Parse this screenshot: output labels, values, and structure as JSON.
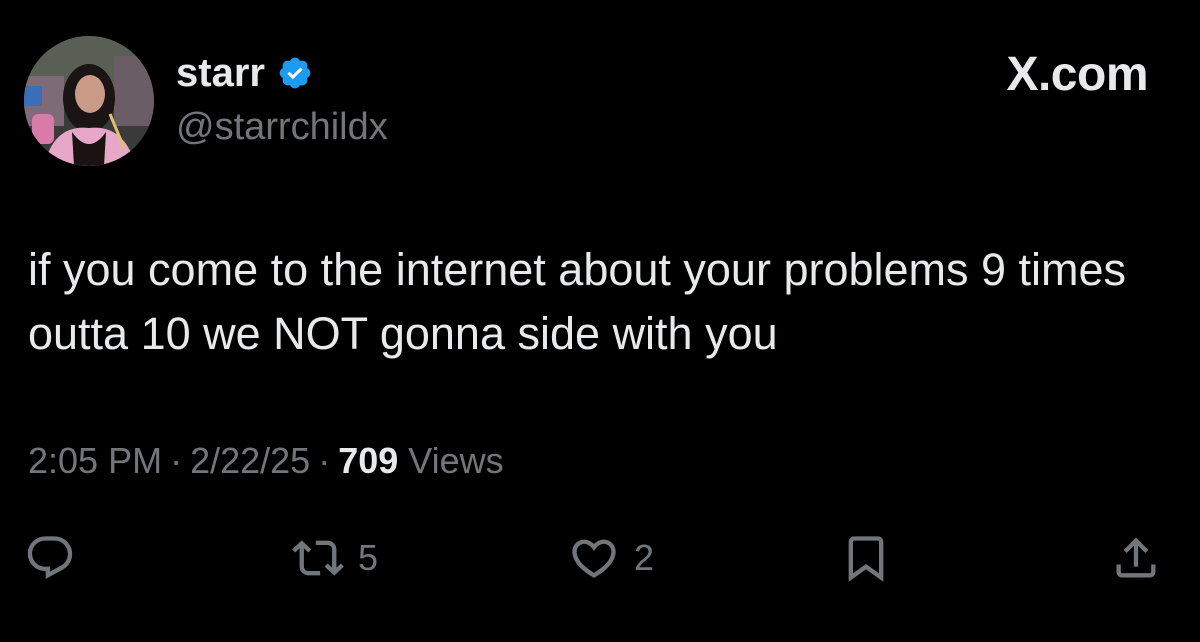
{
  "user": {
    "display_name": "starr",
    "handle": "@starrchildx",
    "verified": true
  },
  "brand": "X.com",
  "tweet": {
    "text": "if you come to the internet about your problems 9 times outta 10 we NOT gonna side with you",
    "time": "2:05 PM",
    "date": "2/22/25",
    "views_count": "709",
    "views_label": "Views"
  },
  "actions": {
    "reply_icon": "reply-icon",
    "retweet_icon": "retweet-icon",
    "retweet_count": "5",
    "like_icon": "heart-icon",
    "like_count": "2",
    "bookmark_icon": "bookmark-icon",
    "share_icon": "share-icon"
  },
  "colors": {
    "background": "#000000",
    "text_primary": "#e7e9ea",
    "text_secondary": "#71767b",
    "verified_badge": "#1d9bf0"
  }
}
